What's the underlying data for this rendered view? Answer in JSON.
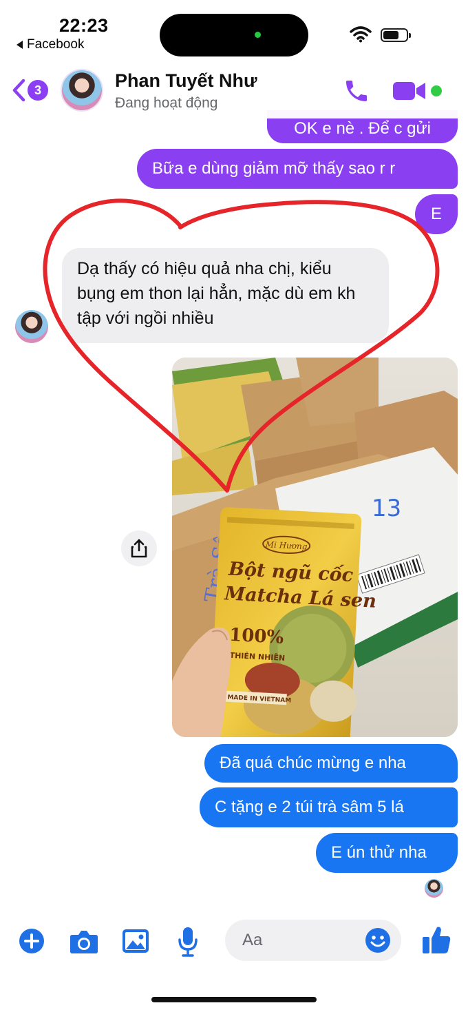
{
  "status_bar": {
    "time": "22:23",
    "back_app": "Facebook",
    "icons": [
      "wifi-icon",
      "battery-icon"
    ]
  },
  "header": {
    "unread_count": "3",
    "contact_name": "Phan Tuyết Như",
    "contact_status": "Đang hoạt động",
    "icons": [
      "phone-icon",
      "video-camera-icon"
    ]
  },
  "messages": [
    {
      "from": "me",
      "text": "OK e nè . Để c gửi"
    },
    {
      "from": "me",
      "text": "Bữa e dùng giảm mỡ thấy sao r r"
    },
    {
      "from": "me",
      "text": "E"
    },
    {
      "from": "contact",
      "text": "Dạ thấy có hiệu quả nha chị, kiểu bụng em thon lại hẳn, mặc dù em kh tập với ngồi nhiều"
    },
    {
      "from": "contact",
      "type": "photo",
      "photo_text": {
        "brand": "Mi Hương",
        "line1": "Bột ngũ cốc",
        "line2": "Matcha Lá sen",
        "percent": "100%",
        "natural": "THIÊN NHIÊN",
        "origin": "MADE IN VIETNAM",
        "box_number": "13",
        "box_scrawl": "Trà Sâm"
      }
    },
    {
      "from": "me",
      "text": "Đã quá chúc mừng e nha"
    },
    {
      "from": "me",
      "text": "C tặng e 2 túi trà sâm 5 lá"
    },
    {
      "from": "me",
      "text": "E ún thử nha"
    }
  ],
  "composer": {
    "placeholder": "Aa",
    "icons": [
      "plus-icon",
      "camera-icon",
      "image-icon",
      "microphone-icon",
      "emoji-icon",
      "thumbs-up-icon"
    ]
  },
  "colors": {
    "accent_purple": "#8a3ff0",
    "accent_blue": "#1976f2",
    "incoming_bubble": "#eeeef0",
    "heart_stroke": "#e5252a",
    "online_green": "#31cc46"
  }
}
